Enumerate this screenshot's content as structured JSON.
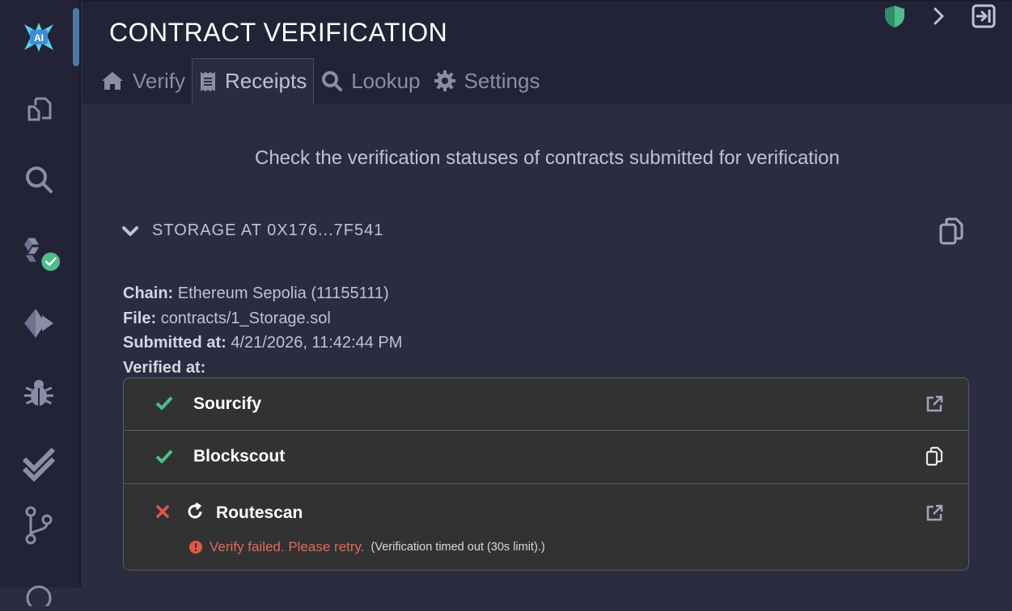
{
  "app": {
    "title": "CONTRACT VERIFICATION",
    "activity_icons": [
      "ai-logo-icon",
      "files-icon",
      "search-icon",
      "solidity-compiler-icon",
      "deploy-run-icon",
      "debugger-icon",
      "contract-verification-icon",
      "git-icon"
    ]
  },
  "tabs": [
    {
      "label": "Verify",
      "icon": "home-icon"
    },
    {
      "label": "Receipts",
      "icon": "receipt-icon",
      "active": true
    },
    {
      "label": "Lookup",
      "icon": "search-icon"
    },
    {
      "label": "Settings",
      "icon": "gear-icon"
    }
  ],
  "main": {
    "subtitle": "Check the verification statuses of contracts submitted for verification"
  },
  "receipt": {
    "header": "STORAGE AT 0X176...7F541",
    "chain_label": "Chain:",
    "chain_value": "Ethereum Sepolia (11155111)",
    "file_label": "File:",
    "file_value": "contracts/1_Storage.sol",
    "submitted_label": "Submitted at:",
    "submitted_value": "4/21/2026, 11:42:44 PM",
    "verified_label": "Verified at:"
  },
  "providers": [
    {
      "name": "Sourcify",
      "status": "success",
      "action": "external-link-icon"
    },
    {
      "name": "Blockscout",
      "status": "success",
      "action": "copy-icon"
    },
    {
      "name": "Routescan",
      "status": "failed",
      "action": "external-link-icon",
      "error": "Verify failed. Please retry.",
      "error_detail": "(Verification timed out (30s limit).)"
    }
  ],
  "colors": {
    "success": "#4dbd8a",
    "error": "#e0584b",
    "accent": "#4c79a8",
    "shield": "#4dbd8a"
  }
}
